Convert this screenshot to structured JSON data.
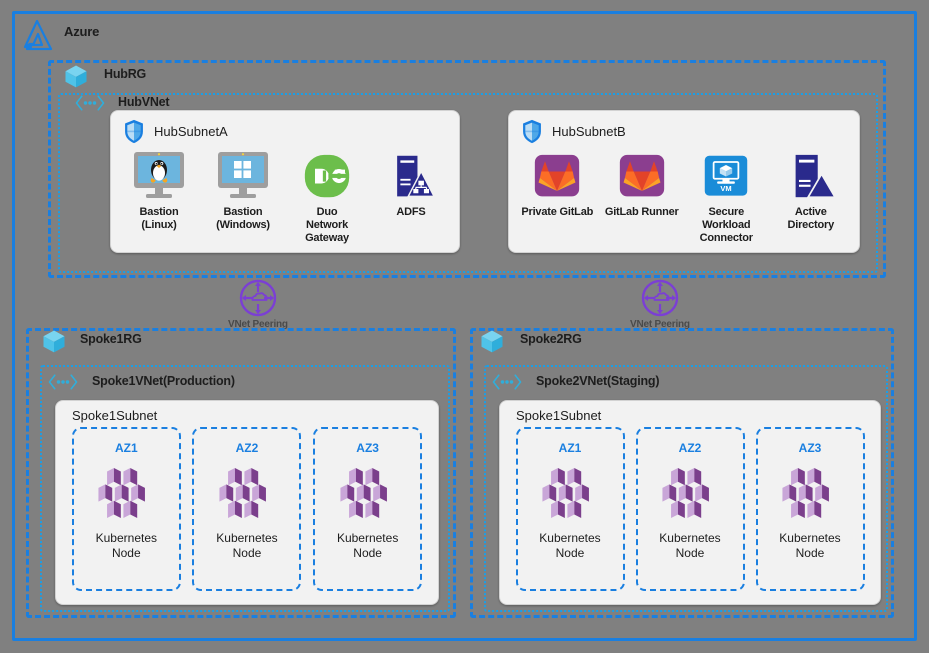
{
  "cloud": {
    "title": "Azure",
    "logo_icon": "azure-logo-icon",
    "border_color": "#1A7FE0"
  },
  "hub": {
    "rg": {
      "label": "HubRG",
      "icon": "resource-group-cube-icon"
    },
    "vnet": {
      "label": "HubVNet",
      "icon": "vnet-icon"
    },
    "subnets": [
      {
        "name": "HubSubnetA",
        "icon": "shield-icon",
        "resources": [
          {
            "label": "Bastion\n(Linux)",
            "line1": "Bastion",
            "line2": "(Linux)",
            "icon": "linux-bastion-monitor-icon",
            "color": "#6CB5DE"
          },
          {
            "label": "Bastion\n(Windows)",
            "line1": "Bastion",
            "line2": "(Windows)",
            "icon": "windows-bastion-monitor-icon",
            "color": "#6CB5DE"
          },
          {
            "label": "Duo Network Gateway",
            "line1": "Duo",
            "line2": "Network",
            "line3": "Gateway",
            "icon": "duo-icon",
            "color": "#6CBE4B"
          },
          {
            "label": "ADFS",
            "line1": "ADFS",
            "icon": "adfs-icon",
            "color": "#2A2A8C"
          }
        ]
      },
      {
        "name": "HubSubnetB",
        "icon": "shield-icon",
        "resources": [
          {
            "label": "Private GitLab",
            "line1": "Private GitLab",
            "icon": "gitlab-icon",
            "color": "#8B3E8F"
          },
          {
            "label": "GitLab Runner",
            "line1": "GitLab Runner",
            "icon": "gitlab-runner-icon",
            "color": "#8B3E8F"
          },
          {
            "label": "Secure Workload Connector",
            "line1": "Secure Workload",
            "line2": "Connector",
            "icon": "virtual-machine-icon",
            "color": "#1A8CD8",
            "badge": "VM"
          },
          {
            "label": "Active Directory",
            "line1": "Active",
            "line2": "Directory",
            "icon": "active-directory-icon",
            "color": "#2A2A8C"
          }
        ]
      }
    ]
  },
  "peering": [
    {
      "label": "VNet Peering",
      "icon": "vnet-peering-icon",
      "color": "#7B3FD4"
    },
    {
      "label": "VNet Peering",
      "icon": "vnet-peering-icon",
      "color": "#7B3FD4"
    }
  ],
  "spokes": [
    {
      "rg": {
        "label": "Spoke1RG",
        "icon": "resource-group-cube-icon"
      },
      "vnet": {
        "label": "Spoke1VNet(Production)",
        "icon": "vnet-icon"
      },
      "subnet_name": "Spoke1Subnet",
      "zones": [
        {
          "label": "AZ1",
          "node_line1": "Kubernetes",
          "node_line2": "Node",
          "icon": "kubernetes-node-icon"
        },
        {
          "label": "AZ2",
          "node_line1": "Kubernetes",
          "node_line2": "Node",
          "icon": "kubernetes-node-icon"
        },
        {
          "label": "AZ3",
          "node_line1": "Kubernetes",
          "node_line2": "Node",
          "icon": "kubernetes-node-icon"
        }
      ]
    },
    {
      "rg": {
        "label": "Spoke2RG",
        "icon": "resource-group-cube-icon"
      },
      "vnet": {
        "label": "Spoke2VNet(Staging)",
        "icon": "vnet-icon"
      },
      "subnet_name": "Spoke1Subnet",
      "zones": [
        {
          "label": "AZ1",
          "node_line1": "Kubernetes",
          "node_line2": "Node",
          "icon": "kubernetes-node-icon"
        },
        {
          "label": "AZ2",
          "node_line1": "Kubernetes",
          "node_line2": "Node",
          "icon": "kubernetes-node-icon"
        },
        {
          "label": "AZ3",
          "node_line1": "Kubernetes",
          "node_line2": "Node",
          "icon": "kubernetes-node-icon"
        }
      ]
    }
  ]
}
